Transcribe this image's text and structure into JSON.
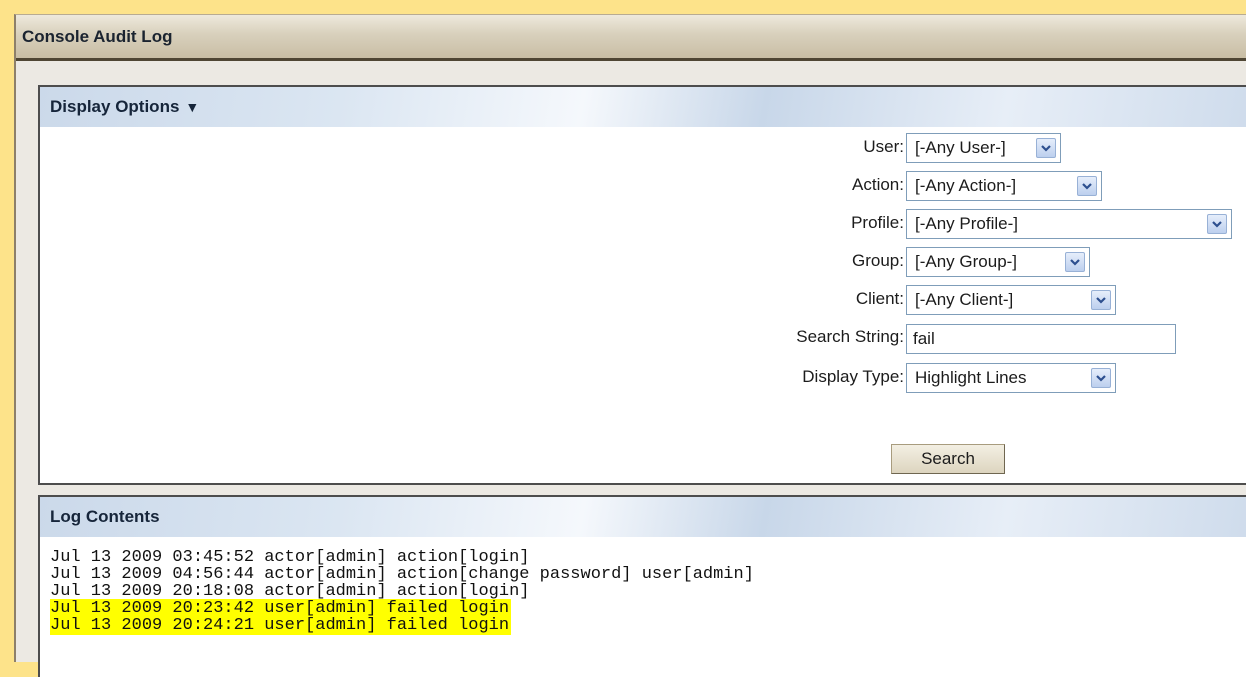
{
  "window": {
    "title": "Console Audit Log"
  },
  "display_options": {
    "header": "Display Options",
    "toggle_icon": "▼",
    "user": {
      "label": "User:",
      "value": "[-Any User-]"
    },
    "action": {
      "label": "Action:",
      "value": "[-Any Action-]"
    },
    "profile": {
      "label": "Profile:",
      "value": "[-Any Profile-]"
    },
    "group": {
      "label": "Group:",
      "value": "[-Any Group-]"
    },
    "client": {
      "label": "Client:",
      "value": "[-Any Client-]"
    },
    "search_string": {
      "label": "Search String:",
      "value": "fail"
    },
    "display_type": {
      "label": "Display Type:",
      "value": "Highlight Lines"
    },
    "search_button": "Search"
  },
  "log": {
    "header": "Log Contents",
    "highlight_color": "#ffff00",
    "lines": [
      {
        "text": "Jul 13 2009 03:45:52 actor[admin] action[login]",
        "highlighted": false
      },
      {
        "text": "Jul 13 2009 04:56:44 actor[admin] action[change password] user[admin]",
        "highlighted": false
      },
      {
        "text": "Jul 13 2009 20:18:08 actor[admin] action[login]",
        "highlighted": false
      },
      {
        "text": "Jul 13 2009 20:23:42 user[admin] failed login",
        "highlighted": true
      },
      {
        "text": "Jul 13 2009 20:24:21 user[admin] failed login",
        "highlighted": true
      }
    ]
  }
}
